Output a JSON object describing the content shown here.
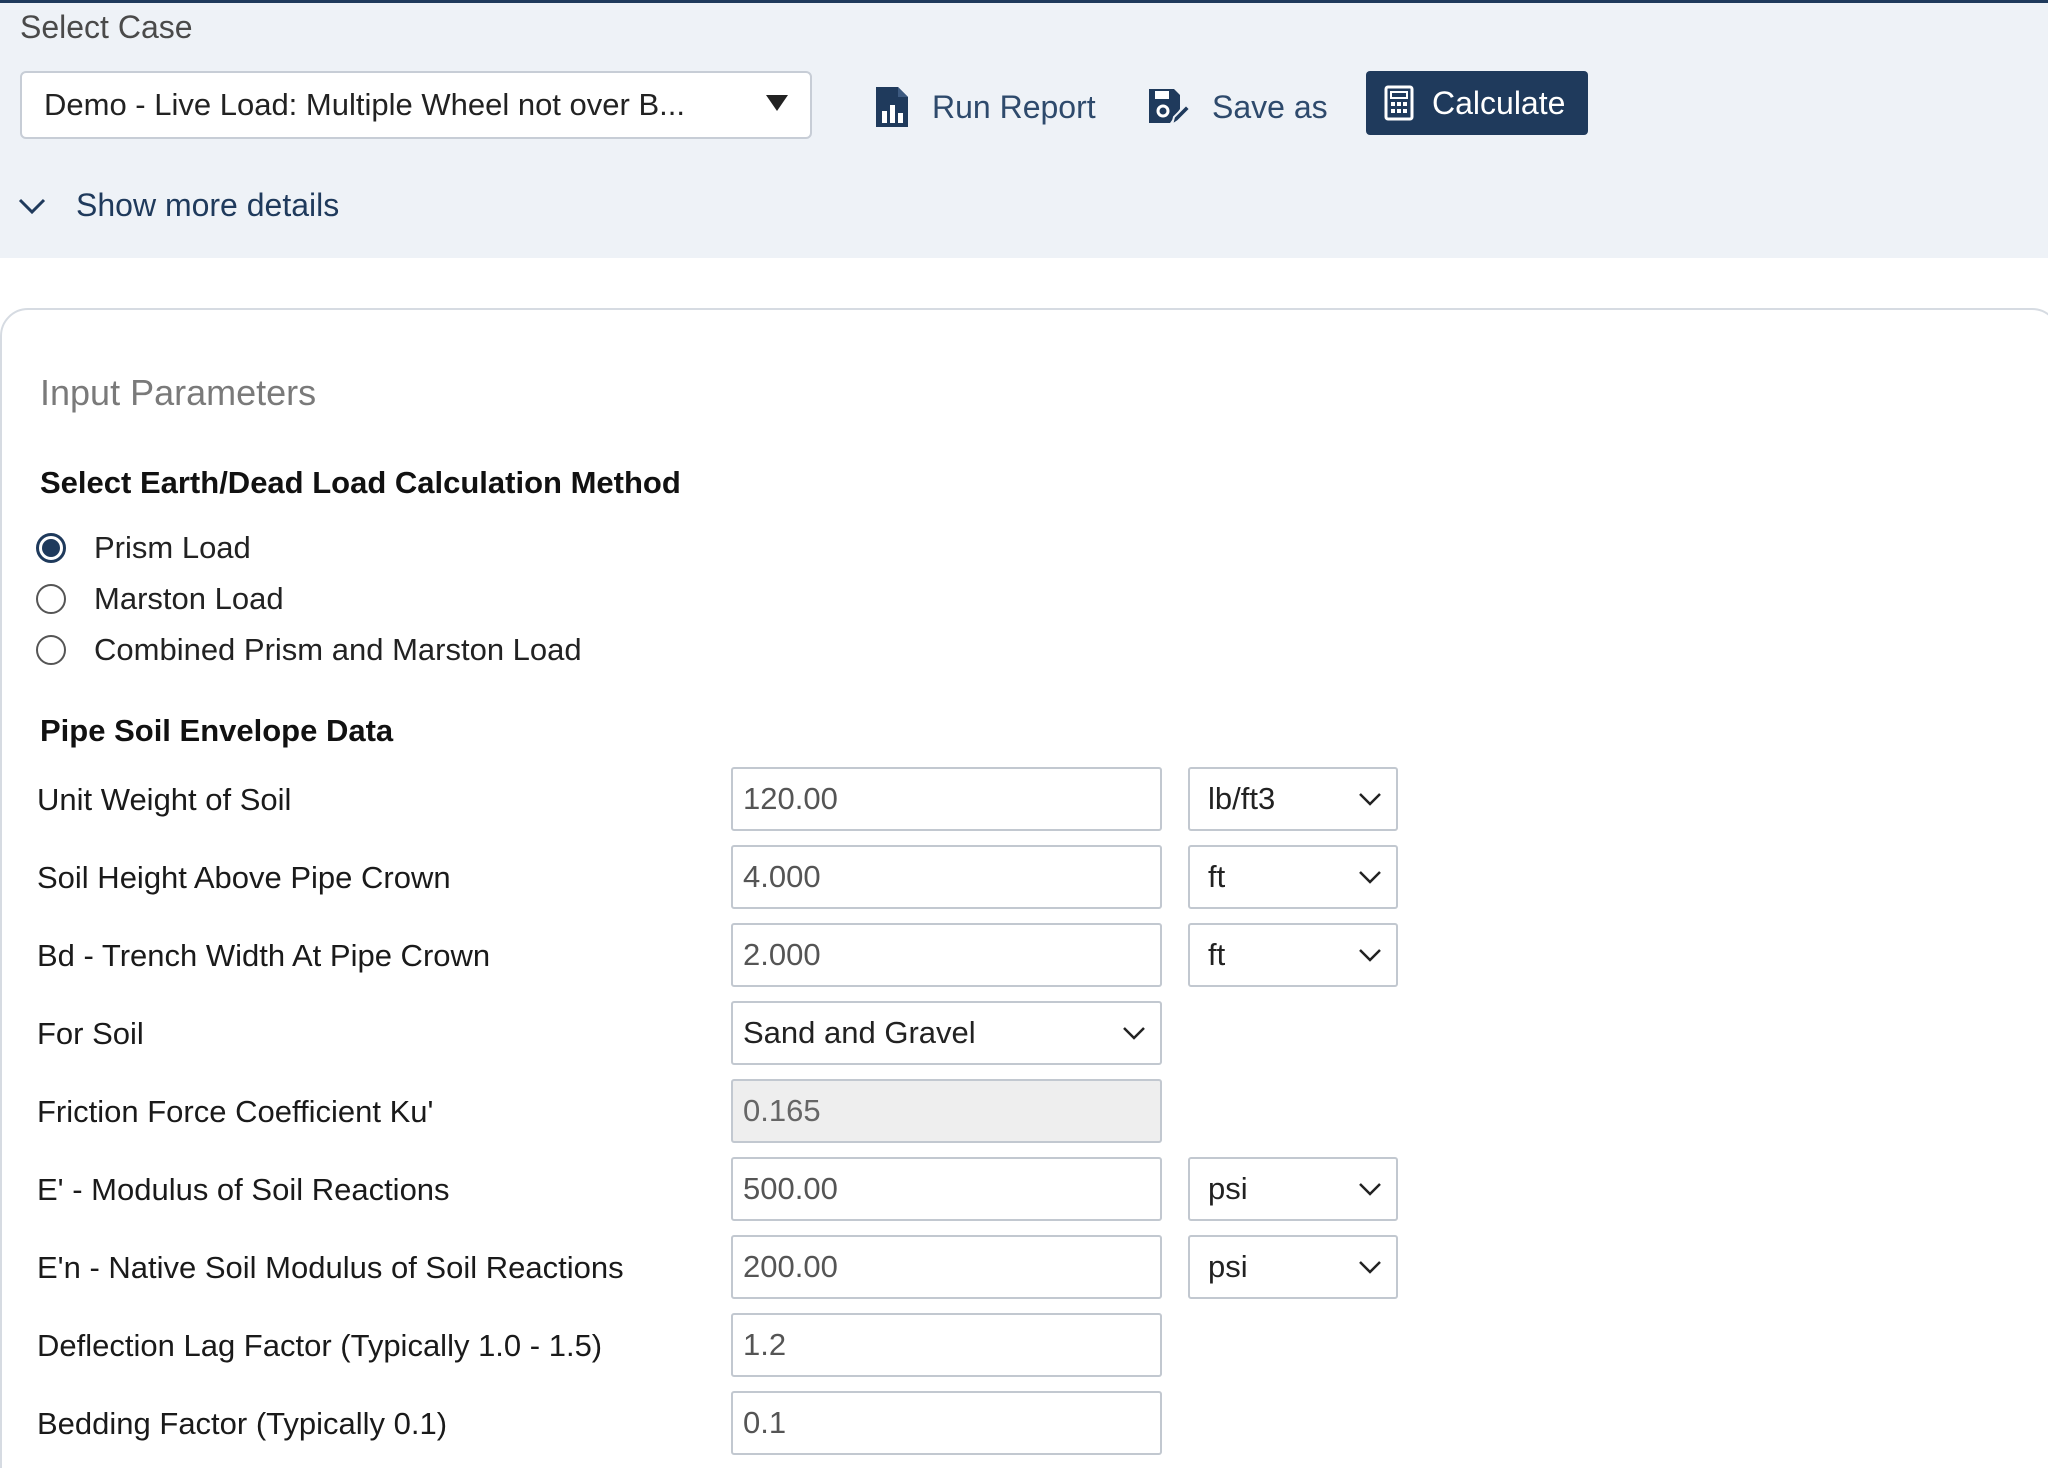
{
  "header": {
    "select_case_label": "Select Case",
    "case_value": "Demo - Live Load: Multiple Wheel not over B...",
    "run_report_label": "Run Report",
    "save_as_label": "Save as",
    "calculate_label": "Calculate",
    "show_more_label": "Show more details"
  },
  "main": {
    "section_title": "Input Parameters",
    "method_title": "Select Earth/Dead Load Calculation Method",
    "methods": [
      {
        "label": "Prism Load",
        "selected": true
      },
      {
        "label": "Marston Load",
        "selected": false
      },
      {
        "label": "Combined Prism and Marston Load",
        "selected": false
      }
    ],
    "envelope_title": "Pipe Soil Envelope Data",
    "fields": {
      "unit_weight": {
        "label": "Unit Weight of Soil",
        "value": "120.00",
        "unit": "lb/ft3"
      },
      "soil_height": {
        "label": "Soil Height Above Pipe Crown",
        "value": "4.000",
        "unit": "ft"
      },
      "trench_width": {
        "label": "Bd - Trench Width At Pipe Crown",
        "value": "2.000",
        "unit": "ft"
      },
      "for_soil": {
        "label": "For Soil",
        "value": "Sand and Gravel"
      },
      "friction": {
        "label": "Friction Force Coefficient Ku'",
        "value": "0.165"
      },
      "modulus": {
        "label": "E' - Modulus of Soil Reactions",
        "value": "500.00",
        "unit": "psi"
      },
      "native_modulus": {
        "label": "E'n - Native Soil Modulus of Soil Reactions",
        "value": "200.00",
        "unit": "psi"
      },
      "deflection_lag": {
        "label": "Deflection Lag Factor (Typically 1.0 - 1.5)",
        "value": "1.2"
      },
      "bedding": {
        "label": "Bedding Factor (Typically 0.1)",
        "value": "0.1"
      }
    }
  },
  "colors": {
    "accent": "#1f3a5c",
    "header_bg": "#eef2f7"
  }
}
